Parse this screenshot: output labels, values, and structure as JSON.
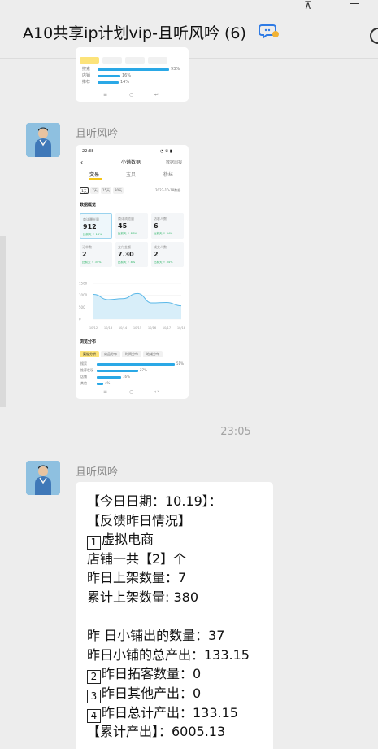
{
  "window": {
    "title": "A10共享ip计划vip-且听风吟 (6)",
    "pin_glyph": "⊼",
    "icons": [
      "pin-icon",
      "minimize-icon",
      "chat-badge-icon",
      "more-icon"
    ]
  },
  "messages": {
    "sender_name": "且听风吟",
    "timestamp": "23:05"
  },
  "top_card": {
    "bar_rows": [
      {
        "label": "搜索",
        "pct": "93%",
        "fraction": 0.93
      },
      {
        "label": "店铺",
        "pct": "16%",
        "fraction": 0.16
      },
      {
        "label": "推荐",
        "pct": "14%",
        "fraction": 0.14
      }
    ],
    "nav": [
      "≡",
      "○",
      "↩"
    ]
  },
  "phone": {
    "status_time": "22:38",
    "status_right": "◔ ✆ ▮",
    "back": "‹",
    "title": "小铺数据",
    "header_action": "数据周报",
    "tabs": [
      "交易",
      "宝贝",
      "粉丝"
    ],
    "range_buttons": [
      "1天",
      "7天",
      "15天",
      "30天"
    ],
    "range_date": "2023-10-18数据",
    "overview_title": "数据概览",
    "metrics": [
      {
        "label": "商详曝光量",
        "value": "912",
        "sub": "比前天 ↑ 16%"
      },
      {
        "label": "商详浏览量",
        "value": "45",
        "sub": "比前天 ↑ 87%"
      },
      {
        "label": "访客人数",
        "value": "6",
        "sub": "比前天 ↑ 34%"
      },
      {
        "label": "订单数",
        "value": "2",
        "sub": "比前天 ↑ 34%"
      },
      {
        "label": "支付金额",
        "value": "7.30",
        "sub": "比前天 ↑ 8%"
      },
      {
        "label": "成交人数",
        "value": "2",
        "sub": "比前天 ↑ 34%"
      }
    ],
    "chart_data": {
      "type": "line",
      "x": [
        "10/12",
        "10/13",
        "10/14",
        "10/15",
        "10/16",
        "10/17",
        "10/18"
      ],
      "y_ticks": [
        "1500",
        "1000",
        "500",
        "0"
      ],
      "values": [
        1040,
        820,
        860,
        1080,
        680,
        700,
        560
      ],
      "ylim": [
        0,
        1500
      ]
    },
    "distribution_title": "浏览分布",
    "dist_tabs": [
      "渠道分析",
      "商品分布",
      "时间分布",
      "地域分布"
    ],
    "dist_rows": [
      {
        "label": "搜索",
        "pct": "51%",
        "fraction": 0.51
      },
      {
        "label": "推荐发现",
        "pct": "27%",
        "fraction": 0.27
      },
      {
        "label": "店铺",
        "pct": "16%",
        "fraction": 0.16
      },
      {
        "label": "其他",
        "pct": "4%",
        "fraction": 0.04
      }
    ],
    "nav": [
      "≡",
      "○",
      "↩"
    ]
  },
  "bubble": {
    "lines": [
      {
        "box": "",
        "text": "【今日日期：10.19】："
      },
      {
        "box": "",
        "text": "【反馈昨日情况】"
      },
      {
        "box": "1",
        "text": "虚拟电商"
      },
      {
        "box": "",
        "text": "店铺一共【2】个"
      },
      {
        "box": "",
        "text": "昨日上架数量：7"
      },
      {
        "box": "",
        "text": "累计上架数量: 380"
      },
      {
        "box": "",
        "text": ""
      },
      {
        "box": "",
        "text": "昨 日小铺出的数量：37"
      },
      {
        "box": "",
        "text": "昨日小铺的总产出：133.15"
      },
      {
        "box": "2",
        "text": "昨日拓客数量：0"
      },
      {
        "box": "3",
        "text": "昨日其他产出：0"
      },
      {
        "box": "4",
        "text": "昨日总计产出：133.15"
      },
      {
        "box": "",
        "text": "【累计产出】：6005.13"
      }
    ]
  }
}
